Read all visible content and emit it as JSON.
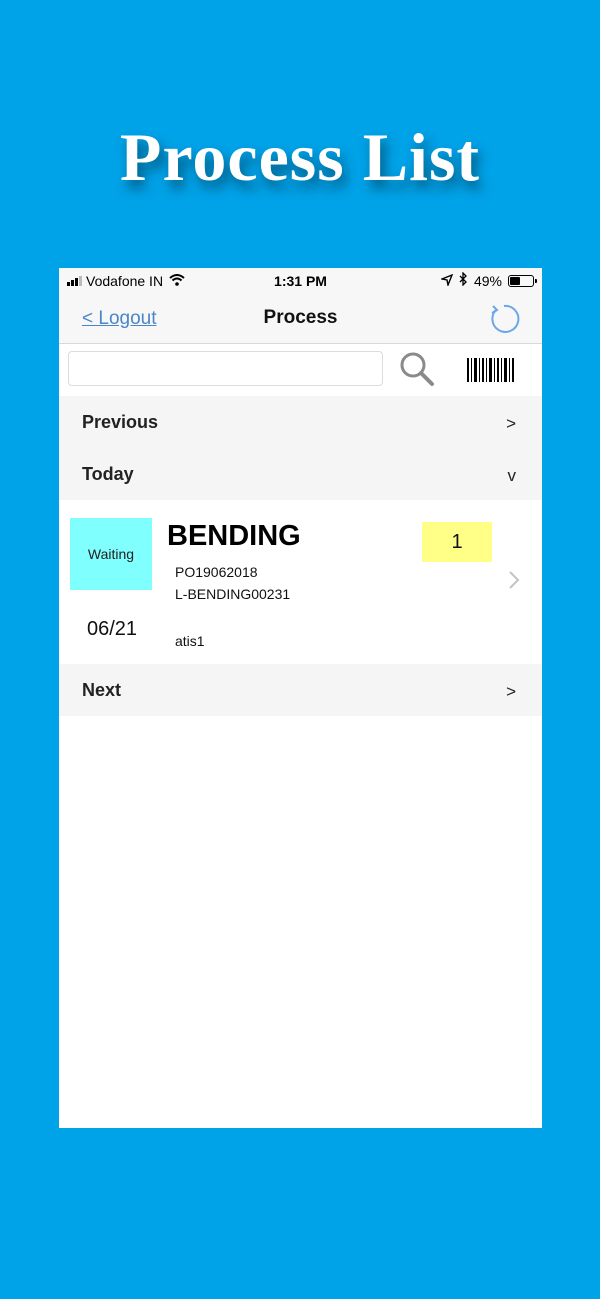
{
  "banner": {
    "title": "Process List"
  },
  "status_bar": {
    "carrier": "Vodafone IN",
    "time": "1:31 PM",
    "battery_percent": "49%",
    "battery_level": 0.49,
    "icons": [
      "signal-icon",
      "wifi-icon",
      "location-icon",
      "bluetooth-icon",
      "battery-icon"
    ]
  },
  "nav": {
    "back_label": "< Logout",
    "title": "Process",
    "refresh_icon": "refresh-icon"
  },
  "search": {
    "value": "",
    "placeholder": "",
    "search_icon": "search-icon",
    "barcode_icon": "barcode-icon"
  },
  "sections": {
    "previous": {
      "label": "Previous",
      "chevron": ">"
    },
    "today": {
      "label": "Today",
      "chevron": "v"
    },
    "next": {
      "label": "Next",
      "chevron": ">"
    }
  },
  "items": [
    {
      "status": "Waiting",
      "status_color": "#80ffff",
      "date": "06/21",
      "process": "BENDING",
      "po": "PO19062018",
      "part": "L-BENDING00231",
      "user": "atis1",
      "quantity": "1",
      "quantity_color": "#ffff88"
    }
  ],
  "colors": {
    "background": "#00a2e8",
    "link": "#4a86c8",
    "section_bg": "#f5f5f5"
  }
}
